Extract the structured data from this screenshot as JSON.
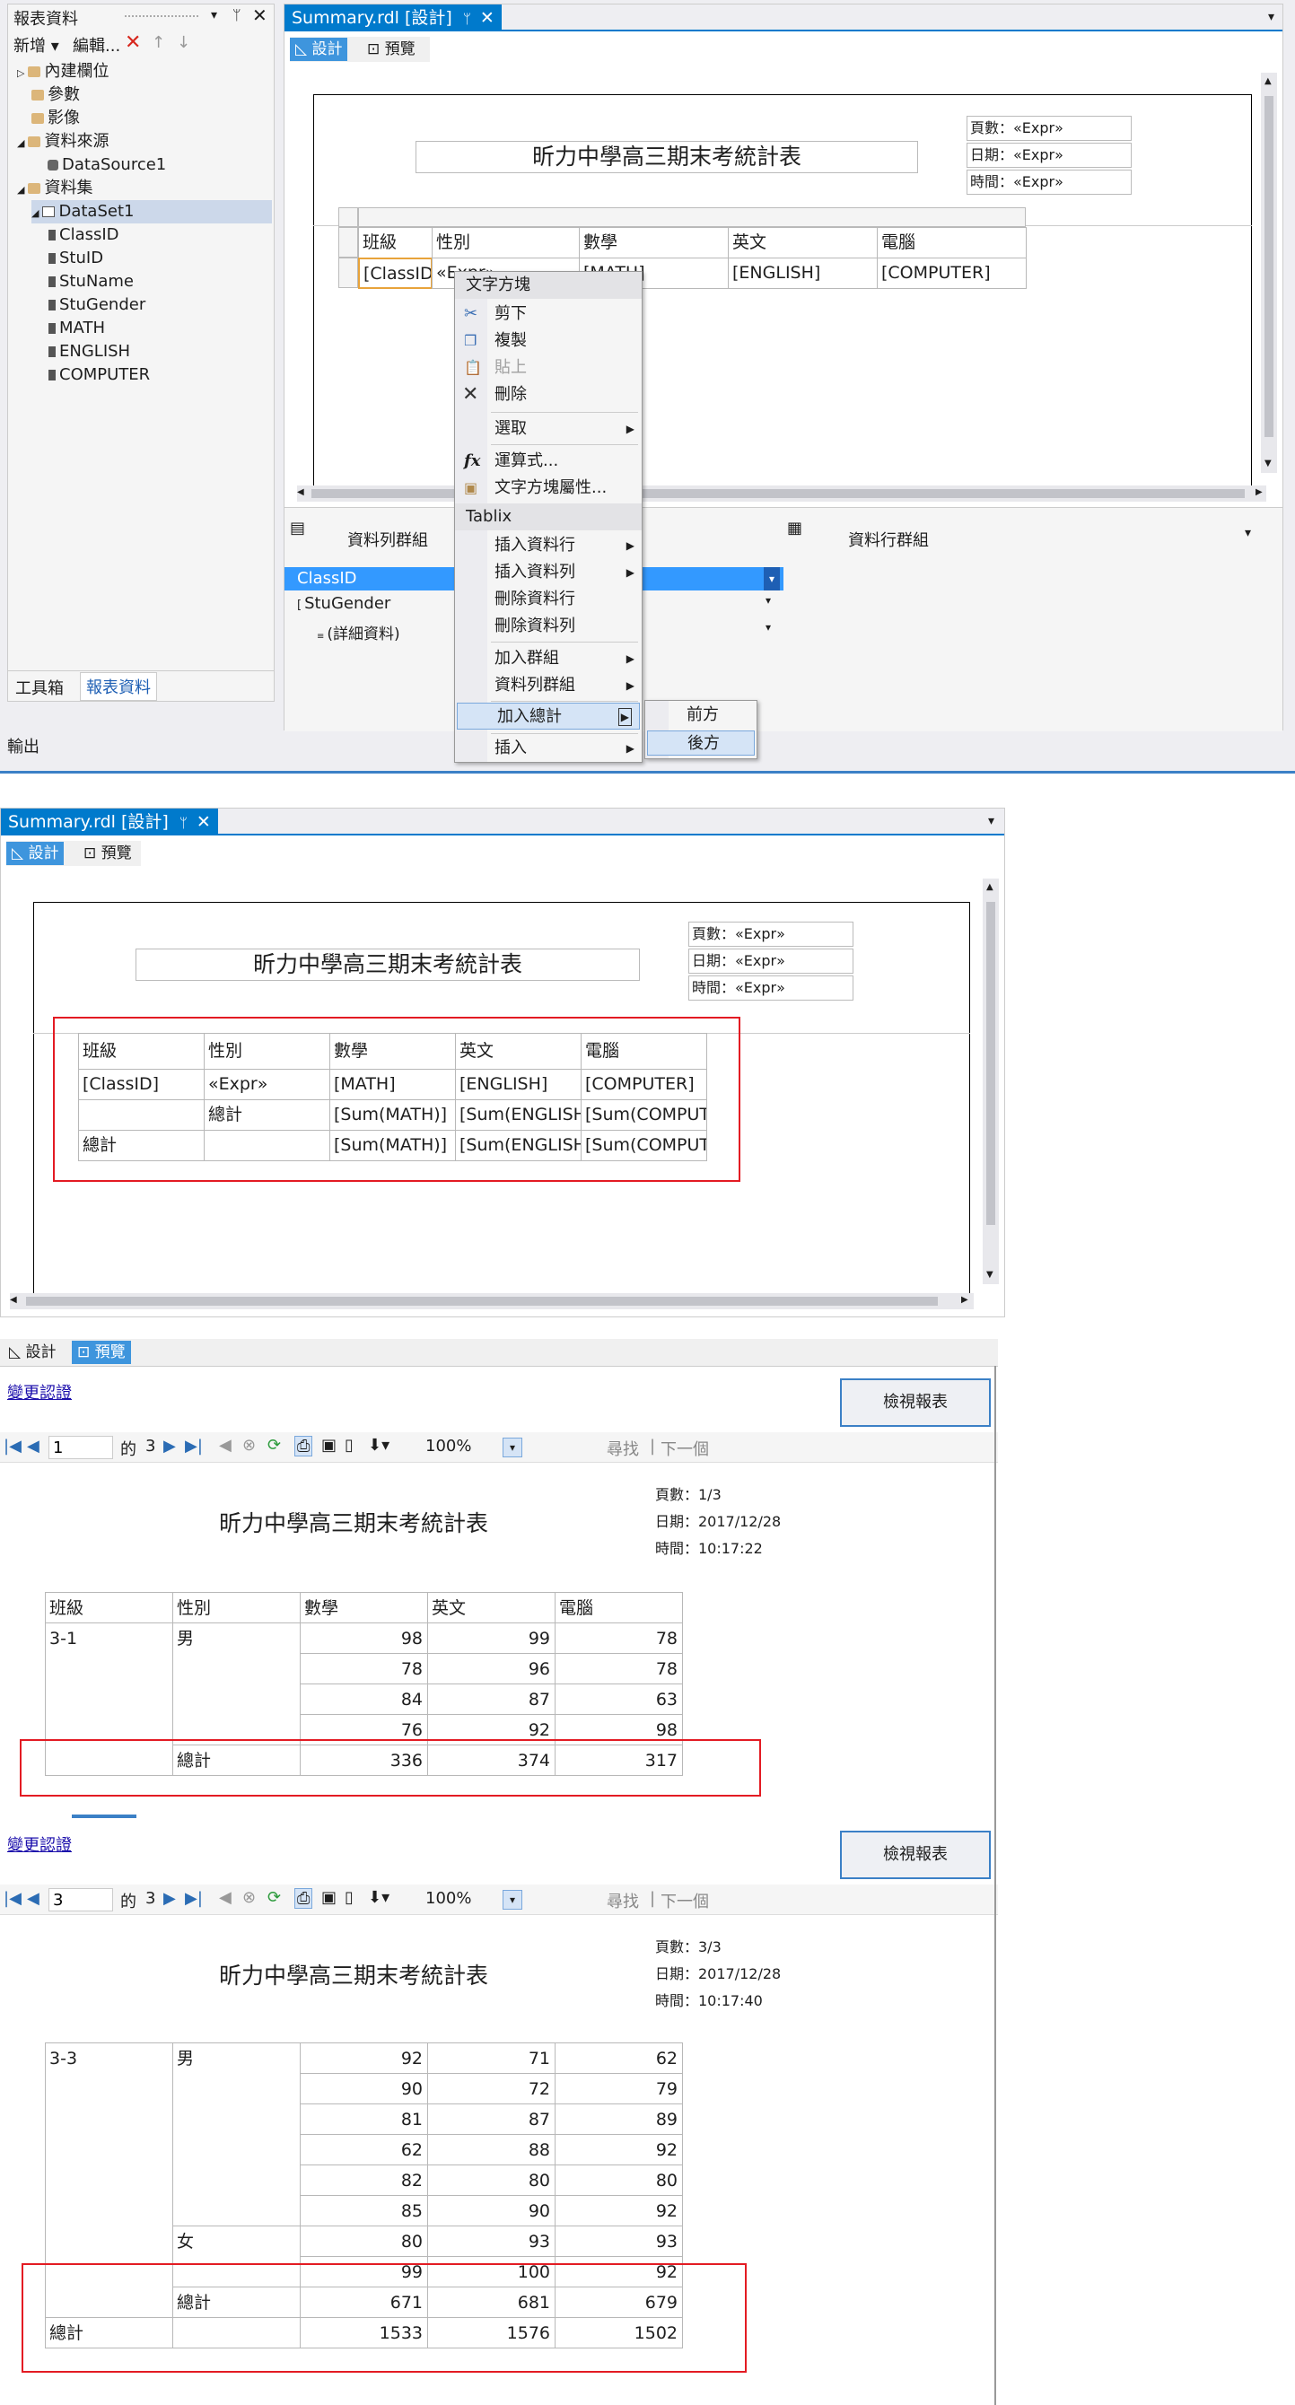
{
  "report_data_panel": {
    "title": "報表資料",
    "toolbar": {
      "new": "新增",
      "edit": "編輯..."
    },
    "tree": {
      "builtin_fields": "內建欄位",
      "parameters": "參數",
      "images": "影像",
      "data_sources": "資料來源",
      "datasource1": "DataSource1",
      "datasets": "資料集",
      "dataset1": "DataSet1",
      "fields": [
        "ClassID",
        "StuID",
        "StuName",
        "StuGender",
        "MATH",
        "ENGLISH",
        "COMPUTER"
      ]
    },
    "bottom_tabs": {
      "toolbox": "工具箱",
      "report_data": "報表資料"
    },
    "output": "輸出"
  },
  "doc_tab": "Summary.rdl [設計]",
  "tabs": {
    "design": "設計",
    "preview": "預覽"
  },
  "report": {
    "title": "昕力中學高三期末考統計表",
    "page_expr": "頁數：«Expr»",
    "date_expr": "日期：«Expr»",
    "time_expr": "時間：«Expr»",
    "headers": [
      "班級",
      "性別",
      "數學",
      "英文",
      "電腦"
    ],
    "detail_row": [
      "[ClassID]",
      "«Expr»",
      "[MATH]",
      "[ENGLISH]",
      "[COMPUTER]"
    ]
  },
  "context_menu": {
    "textbox_header": "文字方塊",
    "cut": "剪下",
    "copy": "複製",
    "paste": "貼上",
    "delete": "刪除",
    "select": "選取",
    "expression": "運算式...",
    "textbox_props": "文字方塊屬性...",
    "tablix_header": "Tablix",
    "insert_row": "插入資料行",
    "insert_col": "插入資料列",
    "delete_row": "刪除資料行",
    "delete_col": "刪除資料列",
    "add_group": "加入群組",
    "row_group": "資料列群組",
    "add_total": "加入總計",
    "insert": "插入",
    "before": "前方",
    "after": "後方"
  },
  "groups": {
    "row_groups": "資料列群組",
    "col_groups": "資料行群組",
    "items": [
      "ClassID",
      "StuGender",
      "(詳細資料)"
    ]
  },
  "design2": {
    "class_row": [
      "[ClassID]",
      "«Expr»",
      "[MATH]",
      "[ENGLISH]",
      "[COMPUTER]"
    ],
    "subtotal_row": [
      "",
      "總計",
      "[Sum(MATH)]",
      "[Sum(ENGLISH",
      "[Sum(COMPUT"
    ],
    "total_row": [
      "總計",
      "",
      "[Sum(MATH)]",
      "[Sum(ENGLISH",
      "[Sum(COMPUT"
    ]
  },
  "preview": {
    "change_credentials": "變更認證",
    "view_report": "檢視報表",
    "of": "的",
    "total_pages": "3",
    "zoom": "100%",
    "find": "尋找",
    "next": "下一個",
    "page1": {
      "page_input": "1",
      "page_info": "頁數：1/3",
      "date_info": "日期：2017/12/28",
      "time_info": "時間：10:17:22",
      "class": "3-1",
      "gender": "男",
      "rows": [
        [
          "98",
          "99",
          "78"
        ],
        [
          "78",
          "96",
          "78"
        ],
        [
          "84",
          "87",
          "63"
        ],
        [
          "76",
          "92",
          "98"
        ]
      ],
      "subtotal_label": "總計",
      "subtotal": [
        "336",
        "374",
        "317"
      ]
    },
    "page3": {
      "page_input": "3",
      "page_info": "頁數：3/3",
      "date_info": "日期：2017/12/28",
      "time_info": "時間：10:17:40",
      "class": "3-3",
      "gender_m": "男",
      "gender_f": "女",
      "rows_m": [
        [
          "92",
          "71",
          "62"
        ],
        [
          "90",
          "72",
          "79"
        ],
        [
          "81",
          "87",
          "89"
        ],
        [
          "62",
          "88",
          "92"
        ],
        [
          "82",
          "80",
          "80"
        ],
        [
          "85",
          "90",
          "92"
        ]
      ],
      "rows_f": [
        [
          "80",
          "93",
          "93"
        ],
        [
          "99",
          "100",
          "92"
        ]
      ],
      "subtotal_label": "總計",
      "subtotal": [
        "671",
        "681",
        "679"
      ],
      "total_label": "總計",
      "total": [
        "1533",
        "1576",
        "1502"
      ]
    }
  }
}
